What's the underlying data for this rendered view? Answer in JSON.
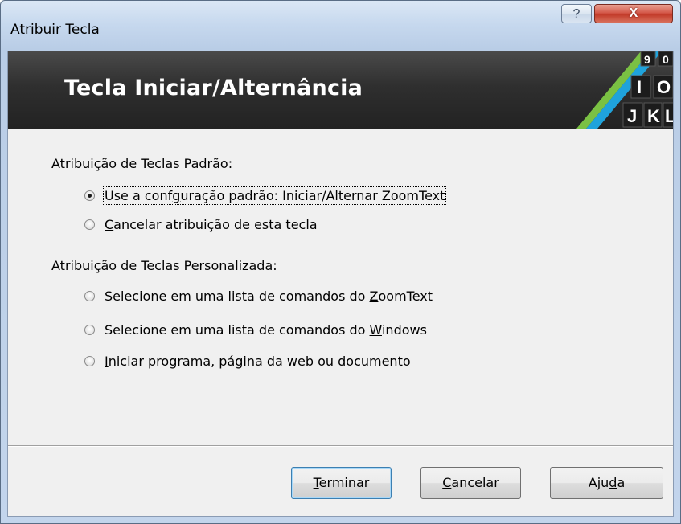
{
  "window": {
    "title": "Atribuir Tecla",
    "help_glyph": "?",
    "close_glyph": "X"
  },
  "banner": {
    "title": "Tecla Iniciar/Alternância",
    "logo_keys": [
      "9",
      "0",
      "I",
      "O",
      "J",
      "K",
      "L"
    ]
  },
  "sections": {
    "default_label": "Atribuição de Teclas Padrão:",
    "custom_label": "Atribuição de Teclas Personalizada:"
  },
  "options": {
    "use_default": {
      "pre": "Use a conf",
      "key": "g",
      "post": "uração padrão: Iniciar/Alternar ZoomText",
      "checked": true
    },
    "cancel_assign": {
      "pre": "",
      "key": "C",
      "post": "ancelar atribuição de esta tecla",
      "checked": false
    },
    "zoomtext_list": {
      "pre": "Selecione em uma lista de comandos do ",
      "key": "Z",
      "post": "oomText",
      "checked": false
    },
    "windows_list": {
      "pre": "Selecione em uma lista de comandos do ",
      "key": "W",
      "post": "indows",
      "checked": false
    },
    "start_program": {
      "pre": "",
      "key": "I",
      "post": "niciar programa, página da web ou documento",
      "checked": false
    }
  },
  "buttons": {
    "finish": {
      "key": "T",
      "rest": "erminar"
    },
    "cancel": {
      "key": "C",
      "rest": "ancelar"
    },
    "help": {
      "pre": "Aju",
      "key": "d",
      "post": "a"
    }
  },
  "colors": {
    "banner_bg": "#2f2f2f",
    "stripe_green": "#7ac143",
    "stripe_blue": "#1fa3dc",
    "close_red": "#c23b2a"
  }
}
